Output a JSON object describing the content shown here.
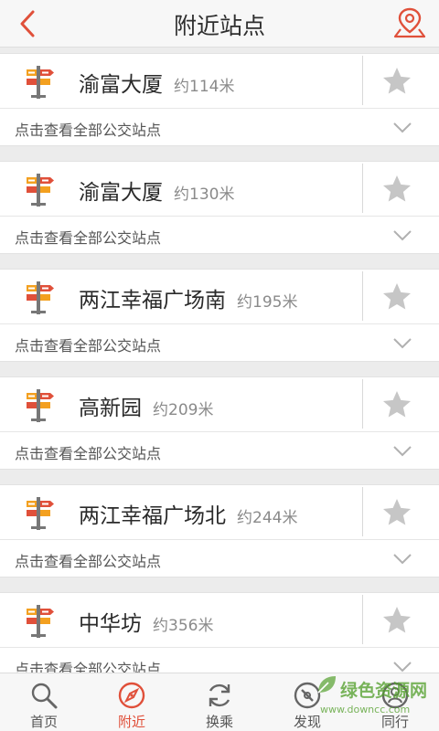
{
  "header": {
    "title": "附近站点",
    "back_icon": "chevron-left-icon",
    "map_icon": "map-pin-icon",
    "accent": "#e0503a"
  },
  "stops": [
    {
      "name": "渝富大厦",
      "distance": "约114米",
      "all_label": "点击查看全部公交站点"
    },
    {
      "name": "渝富大厦",
      "distance": "约130米",
      "all_label": "点击查看全部公交站点"
    },
    {
      "name": "两江幸福广场南",
      "distance": "约195米",
      "all_label": "点击查看全部公交站点"
    },
    {
      "name": "高新园",
      "distance": "约209米",
      "all_label": "点击查看全部公交站点"
    },
    {
      "name": "两江幸福广场北",
      "distance": "约244米",
      "all_label": "点击查看全部公交站点"
    },
    {
      "name": "中华坊",
      "distance": "约356米",
      "all_label": "点击查看全部公交站点"
    }
  ],
  "tabs": [
    {
      "label": "首页",
      "icon": "search-icon",
      "active": false
    },
    {
      "label": "附近",
      "icon": "compass-icon",
      "active": true
    },
    {
      "label": "换乘",
      "icon": "refresh-icon",
      "active": false
    },
    {
      "label": "发现",
      "icon": "discover-icon",
      "active": false
    },
    {
      "label": "同行",
      "icon": "companion-icon",
      "active": false
    }
  ],
  "watermark": {
    "title": "绿色资源网",
    "url": "www.downcc.com"
  },
  "colors": {
    "accent": "#e0503a",
    "sign_orange": "#f3a020",
    "sign_red": "#e0503a",
    "star_gray": "#c6c6c6"
  }
}
